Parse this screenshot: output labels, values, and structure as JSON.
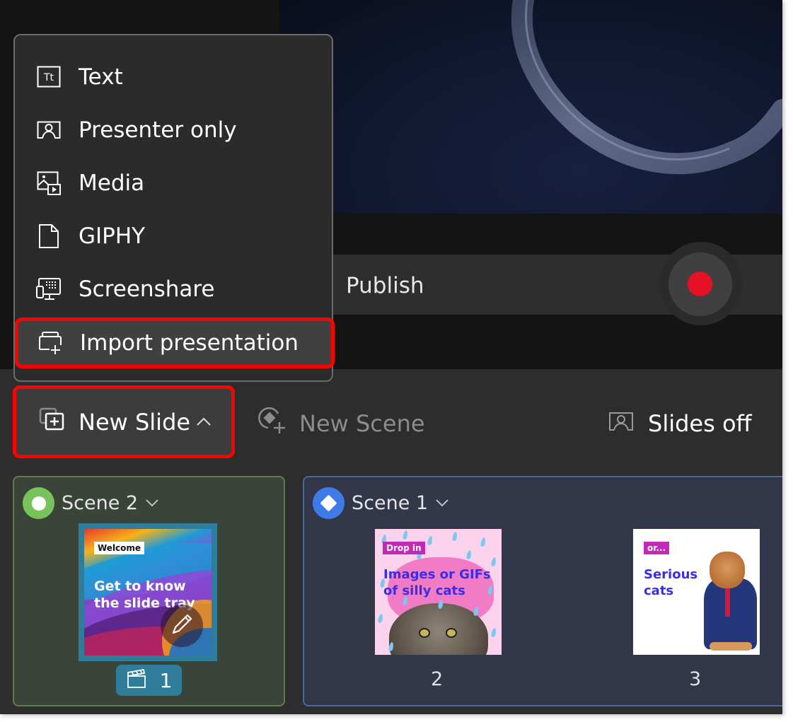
{
  "menu": {
    "items": [
      {
        "label": "Text",
        "icon": "text-tt-icon"
      },
      {
        "label": "Presenter only",
        "icon": "presenter-icon"
      },
      {
        "label": "Media",
        "icon": "media-icon"
      },
      {
        "label": "GIPHY",
        "icon": "document-icon"
      },
      {
        "label": "Screenshare",
        "icon": "screenshare-icon"
      },
      {
        "label": "Import presentation",
        "icon": "import-presentation-icon",
        "highlighted": true
      }
    ]
  },
  "publish": {
    "label": "Publish"
  },
  "record": {
    "color": "#e81123"
  },
  "toolbar": {
    "new_slide": "New Slide",
    "new_slide_chevron": "^",
    "new_scene": "New Scene",
    "slides_off": "Slides off"
  },
  "scenes": [
    {
      "name": "Scene 2",
      "chevron": "⌄",
      "color": "#78c25b",
      "slides": [
        {
          "tag": "Welcome",
          "title": "Get to know the slide tray",
          "title_lines": [
            "Get to know",
            "the slide tray"
          ],
          "number": "1"
        }
      ]
    },
    {
      "name": "Scene 1",
      "chevron": "⌄",
      "color": "#3f7be8",
      "slides": [
        {
          "tag": "Drop in",
          "title_lines": [
            "Images or GIFs",
            "of silly cats"
          ],
          "number": "2"
        },
        {
          "tag": "or...",
          "title_lines": [
            "Serious",
            "cats"
          ],
          "number": "3"
        }
      ]
    }
  ],
  "highlight_color": "#ff0000"
}
